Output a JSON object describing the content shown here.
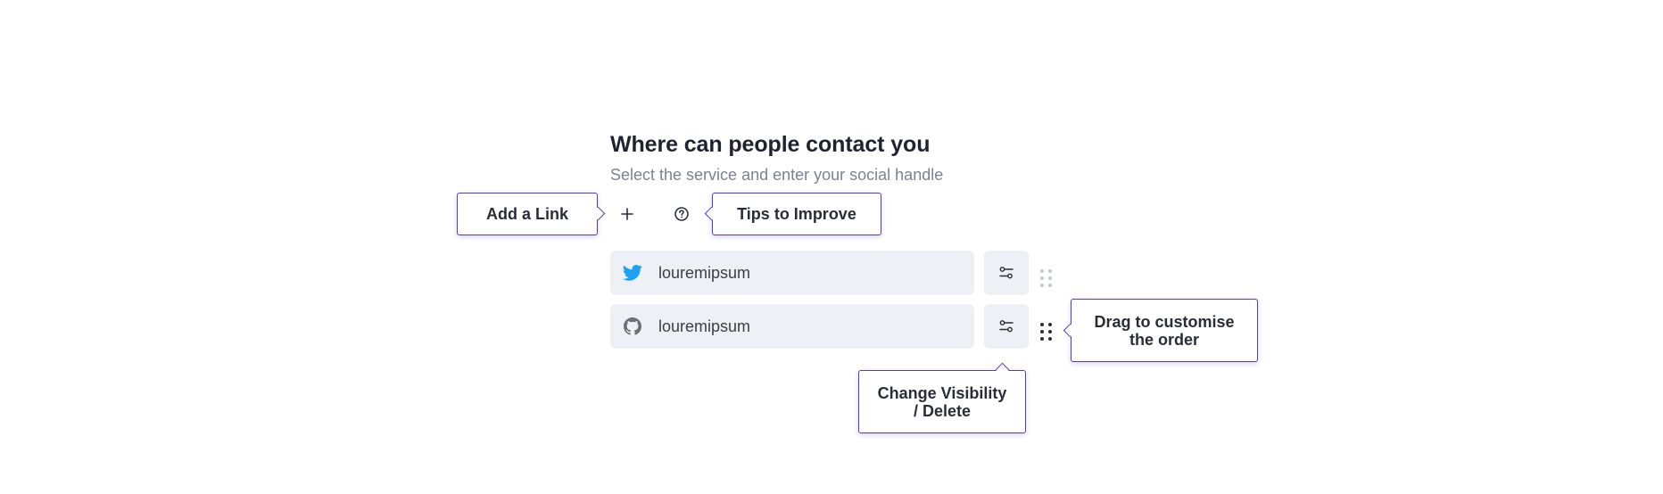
{
  "header": {
    "title": "Where can people contact you",
    "subtitle": "Select the service and enter your social handle"
  },
  "toolbar": {
    "add_icon": "plus-icon",
    "help_icon": "help-circle-icon"
  },
  "callouts": {
    "add_link": "Add a Link",
    "tips": "Tips to Improve",
    "visibility_line1": "Change Visibility",
    "visibility_line2": "/ Delete",
    "drag_line1": "Drag to customise",
    "drag_line2": "the order"
  },
  "links": [
    {
      "service": "twitter",
      "icon": "twitter-icon",
      "handle": "louremipsum",
      "drag_handle_color": "#c4c7ce"
    },
    {
      "service": "github",
      "icon": "github-icon",
      "handle": "louremipsum",
      "drag_handle_color": "#2a2d38"
    }
  ],
  "colors": {
    "callout_border": "#4c3bd0",
    "field_bg": "#edf0f4",
    "twitter_blue": "#1da1f2",
    "github_gray": "#6b6f78"
  }
}
